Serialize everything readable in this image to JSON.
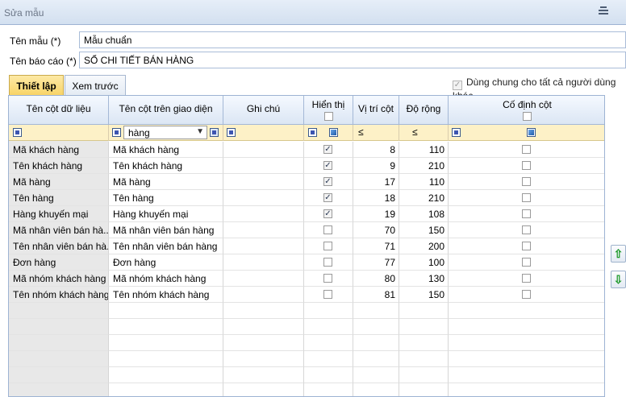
{
  "window": {
    "title": "Sửa mẫu"
  },
  "form": {
    "template_name_label": "Tên mẫu (*)",
    "template_name_value": "Mẫu chuẩn",
    "report_name_label": "Tên báo cáo (*)",
    "report_name_value": "SỔ CHI TIẾT BÁN HÀNG"
  },
  "tabs": [
    {
      "label": "Thiết lập",
      "active": true
    },
    {
      "label": "Xem trước",
      "active": false
    }
  ],
  "share_all": {
    "label": "Dùng chung cho tất cả người dùng khác",
    "checked": true
  },
  "grid": {
    "columns": [
      "Tên cột dữ liệu",
      "Tên cột trên giao diện",
      "Ghi chú",
      "Hiển thị",
      "Vị trí cột",
      "Độ rộng",
      "Cố định cột"
    ],
    "filter": {
      "display_name_value": "hàng",
      "position_op": "≤",
      "width_op": "≤"
    },
    "rows": [
      {
        "data": "Mã khách hàng",
        "display": "Mã khách hàng",
        "note": "",
        "visible": true,
        "pos": "8",
        "width": "110",
        "fixed": false
      },
      {
        "data": "Tên khách hàng",
        "display": "Tên khách hàng",
        "note": "",
        "visible": true,
        "pos": "9",
        "width": "210",
        "fixed": false
      },
      {
        "data": "Mã hàng",
        "display": "Mã hàng",
        "note": "",
        "visible": true,
        "pos": "17",
        "width": "110",
        "fixed": false
      },
      {
        "data": "Tên hàng",
        "display": "Tên hàng",
        "note": "",
        "visible": true,
        "pos": "18",
        "width": "210",
        "fixed": false
      },
      {
        "data": "Hàng khuyến mại",
        "display": "Hàng khuyến mại",
        "note": "",
        "visible": true,
        "pos": "19",
        "width": "108",
        "fixed": false
      },
      {
        "data": "Mã nhân viên bán hà...",
        "display": "Mã nhân viên bán hàng",
        "note": "",
        "visible": false,
        "pos": "70",
        "width": "150",
        "fixed": false
      },
      {
        "data": "Tên nhân viên bán hà...",
        "display": "Tên nhân viên bán hàng",
        "note": "",
        "visible": false,
        "pos": "71",
        "width": "200",
        "fixed": false
      },
      {
        "data": "Đơn hàng",
        "display": "Đơn hàng",
        "note": "",
        "visible": false,
        "pos": "77",
        "width": "100",
        "fixed": false
      },
      {
        "data": "Mã nhóm khách hàng",
        "display": "Mã nhóm khách hàng",
        "note": "",
        "visible": false,
        "pos": "80",
        "width": "130",
        "fixed": false
      },
      {
        "data": "Tên nhóm khách hàng",
        "display": "Tên nhóm khách hàng",
        "note": "",
        "visible": false,
        "pos": "81",
        "width": "150",
        "fixed": false
      }
    ]
  },
  "icons": {
    "move_up": "arrow-up-icon",
    "move_down": "arrow-down-icon"
  },
  "colors": {
    "tab_active": "#f8d468",
    "filter_row": "#fdf1c7",
    "header": "#dbe6f4",
    "arrow": "#1e9a2b"
  }
}
